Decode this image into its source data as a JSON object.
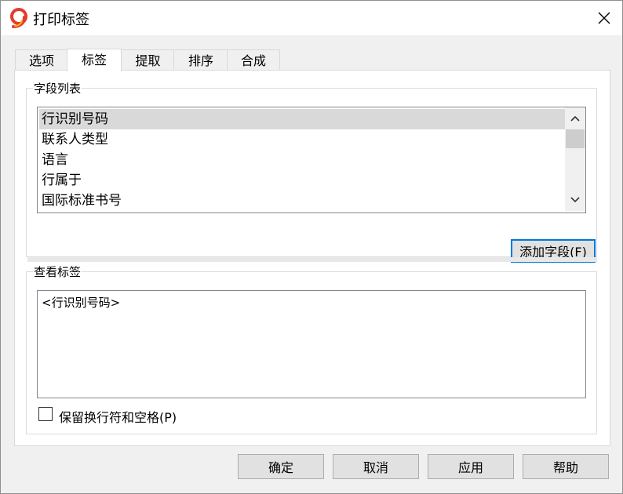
{
  "window": {
    "title": "打印标签",
    "app_icon_glyph": "9",
    "app_icon_color": "#e63a2e"
  },
  "tabs": [
    {
      "label": "选项",
      "active": false
    },
    {
      "label": "标签",
      "active": true
    },
    {
      "label": "提取",
      "active": false
    },
    {
      "label": "排序",
      "active": false
    },
    {
      "label": "合成",
      "active": false
    }
  ],
  "field_list": {
    "group_label": "字段列表",
    "items": [
      "行识别号码",
      "联系人类型",
      "语言",
      "行属于",
      "国际标准书号"
    ],
    "selected_index": 0,
    "add_button_label": "添加字段(F)"
  },
  "view_label": {
    "group_label": "查看标签",
    "content": "<行识别号码>",
    "preserve_checkbox_label": "保留换行符和空格(P)",
    "preserve_checked": false
  },
  "buttons": {
    "ok": "确定",
    "cancel": "取消",
    "apply": "应用",
    "help": "帮助"
  },
  "colors": {
    "accent": "#0078d7",
    "selection": "#d9d9d9"
  }
}
